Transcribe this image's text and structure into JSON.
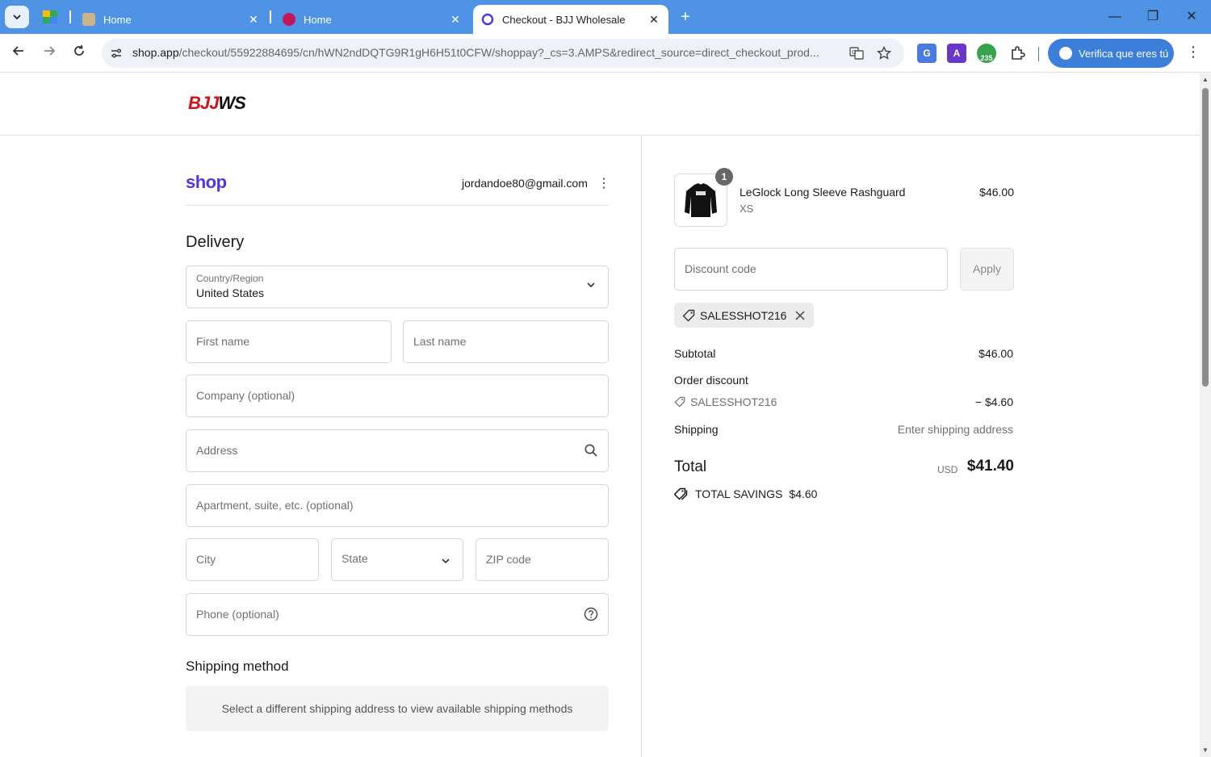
{
  "browser": {
    "tabs": [
      {
        "title": "Home"
      },
      {
        "title": "Home"
      },
      {
        "title": "Checkout - BJJ Wholesale"
      }
    ],
    "url_main": "shop.app",
    "url_rest": "/checkout/55922884695/cn/hWN2ndDQTG9R1gH6H51t0CFW/shoppay?_cs=3.AMPS&redirect_source=direct_checkout_prod...",
    "ext_badge": "235",
    "verify_label": "Verifica que eres tú",
    "accent": "#4f94e4"
  },
  "site": {
    "logo_red": "BJJ",
    "logo_black": "WS"
  },
  "checkout": {
    "shop_logo": "shop",
    "account_email": "jordandoe80@gmail.com",
    "delivery_title": "Delivery",
    "country_label": "Country/Region",
    "country_value": "United States",
    "first_name_ph": "First name",
    "last_name_ph": "Last name",
    "company_ph": "Company (optional)",
    "address_ph": "Address",
    "apartment_ph": "Apartment, suite, etc. (optional)",
    "city_ph": "City",
    "state_ph": "State",
    "zip_ph": "ZIP code",
    "phone_ph": "Phone (optional)",
    "shipping_method_title": "Shipping method",
    "shipping_note": "Select a different shipping address to view available shipping methods"
  },
  "summary": {
    "item": {
      "name": "LeGlock Long Sleeve Rashguard",
      "variant": "XS",
      "price": "$46.00",
      "quantity": "1"
    },
    "discount_ph": "Discount code",
    "apply_label": "Apply",
    "applied_code": "SALESSHOT216",
    "subtotal_label": "Subtotal",
    "subtotal_value": "$46.00",
    "order_discount_label": "Order discount",
    "order_discount_code": "SALESSHOT216",
    "order_discount_value": "− $4.60",
    "shipping_label": "Shipping",
    "shipping_value": "Enter shipping address",
    "total_label": "Total",
    "total_currency": "USD",
    "total_value": "$41.40",
    "savings_label": "TOTAL SAVINGS",
    "savings_value": "$4.60"
  }
}
